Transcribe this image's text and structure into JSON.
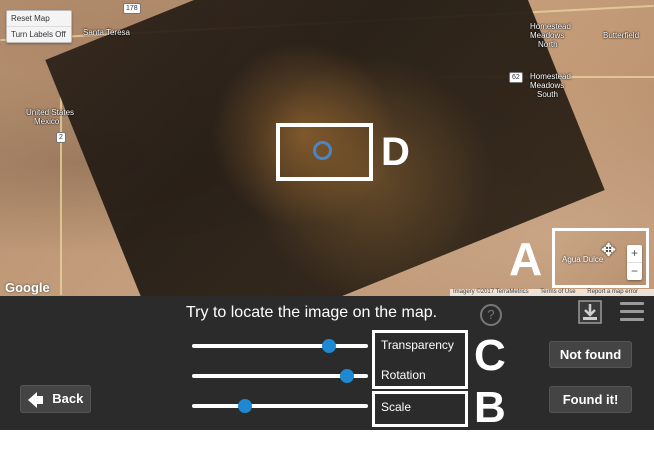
{
  "map": {
    "controls": {
      "reset_label": "Reset Map",
      "labels_label": "Turn Labels Off"
    },
    "places": {
      "santa_teresa": "Santa Teresa",
      "homestead_north_1": "Homestead",
      "homestead_north_2": "Meadows",
      "homestead_north_3": "North",
      "butterfield": "Butterfield",
      "homestead_south_1": "Homestead",
      "homestead_south_2": "Meadows",
      "homestead_south_3": "South",
      "us_mexico_1": "United States",
      "us_mexico_2": "Mexico",
      "agua_dulce": "Agua Dulce"
    },
    "road_signs": {
      "r178": "178",
      "r62": "62",
      "r2": "2"
    },
    "logo": "Google",
    "footer": {
      "imagery": "Imagery ©2017 TerraMetrics",
      "terms": "Terms of Use",
      "report": "Report a map error"
    },
    "annotation_d": "D",
    "annotation_a": "A",
    "zoom_in": "+",
    "zoom_out": "−"
  },
  "panel": {
    "instruction": "Try to locate the image on the map.",
    "help": "?",
    "sliders": {
      "transparency": {
        "label": "Transparency",
        "value": 0.78
      },
      "rotation": {
        "label": "Rotation",
        "value": 0.88
      },
      "scale": {
        "label": "Scale",
        "value": 0.3
      }
    },
    "annotation_c": "C",
    "annotation_b": "B",
    "back_label": "Back",
    "not_found_label": "Not found",
    "found_label": "Found it!"
  }
}
